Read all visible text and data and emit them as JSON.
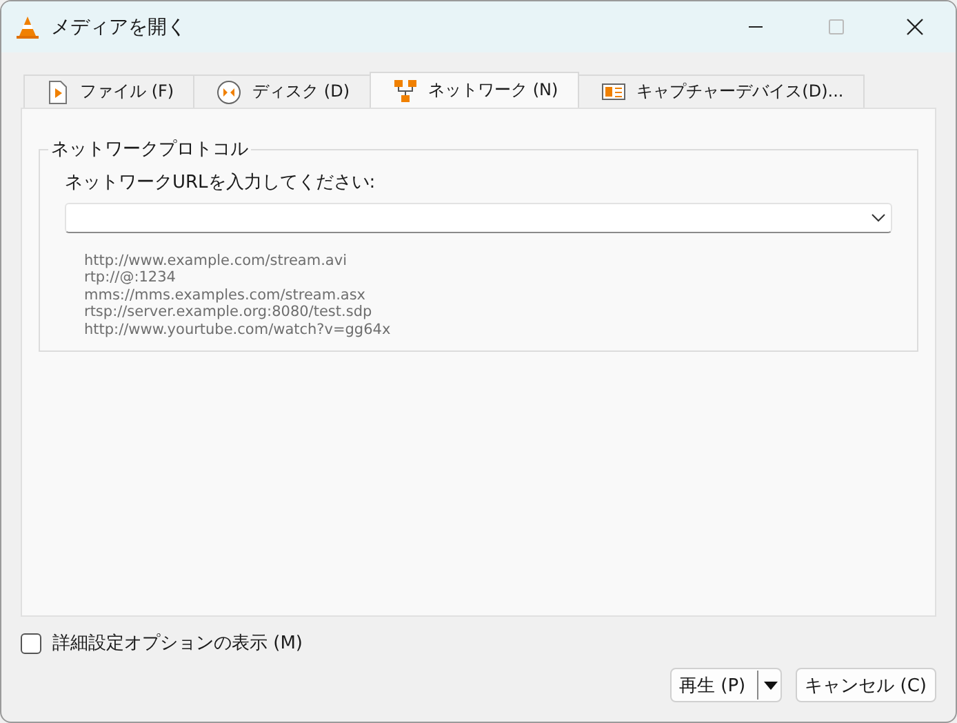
{
  "window": {
    "title": "メディアを開く"
  },
  "tabs": [
    {
      "label": "ファイル (F)",
      "kind": "file",
      "selected": false
    },
    {
      "label": "ディスク (D)",
      "kind": "disc",
      "selected": false
    },
    {
      "label": "ネットワーク (N)",
      "kind": "network",
      "selected": true
    },
    {
      "label": "キャプチャーデバイス(D)...",
      "kind": "capture",
      "selected": false
    }
  ],
  "network_protocol": {
    "title": "ネットワークプロトコル",
    "url_label": "ネットワークURLを入力してください:",
    "examples": [
      "http://www.example.com/stream.avi",
      "rtp://@:1234",
      "mms://mms.examples.com/stream.asx",
      "rtsp://server.example.org:8080/test.sdp",
      "http://www.yourtube.com/watch?v=gg64x"
    ]
  },
  "advanced_options": {
    "label": "詳細設定オプションの表示 (M)",
    "checked": false
  },
  "buttons": [
    {
      "label": "再生 (P)",
      "kind": "split"
    },
    {
      "label": "キャンセル (C)",
      "kind": "plain"
    }
  ]
}
